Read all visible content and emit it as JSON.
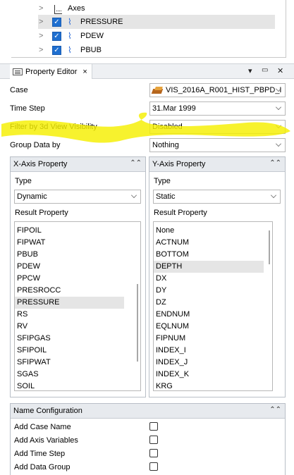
{
  "tree": {
    "items": [
      {
        "label": "Axes",
        "checked": false
      },
      {
        "label": "PRESSURE",
        "checked": true,
        "selected": true
      },
      {
        "label": "PDEW",
        "checked": true
      },
      {
        "label": "PBUB",
        "checked": true
      }
    ]
  },
  "property_editor": {
    "tab_title": "Property Editor",
    "tab_close": "×",
    "menu_glyph": "▾",
    "float_glyph": "🗗",
    "close_glyph": "✕"
  },
  "form": {
    "case_label": "Case",
    "case_value": "VIS_2016A_R001_HIST_PBPD_I",
    "time_step_label": "Time Step",
    "time_step_value": "31.Mar 1999",
    "filter_label": "Filter by 3d View Visibility",
    "filter_value": "Disabled",
    "group_label": "Group Data by",
    "group_value": "Nothing"
  },
  "x_axis": {
    "title": "X-Axis Property",
    "type_label": "Type",
    "type_value": "Dynamic",
    "result_label": "Result Property",
    "items": [
      "FIPOIL",
      "FIPWAT",
      "PBUB",
      "PDEW",
      "PPCW",
      "PRESROCC",
      "PRESSURE",
      "RS",
      "RV",
      "SFIPGAS",
      "SFIPOIL",
      "SFIPWAT",
      "SGAS",
      "SOIL"
    ],
    "selected": "PRESSURE"
  },
  "y_axis": {
    "title": "Y-Axis Property",
    "type_label": "Type",
    "type_value": "Static",
    "result_label": "Result Property",
    "items": [
      "None",
      "ACTNUM",
      "BOTTOM",
      "DEPTH",
      "DX",
      "DY",
      "DZ",
      "ENDNUM",
      "EQLNUM",
      "FIPNUM",
      "INDEX_I",
      "INDEX_J",
      "INDEX_K",
      "KRG"
    ],
    "selected": "DEPTH"
  },
  "name_config": {
    "title": "Name Configuration",
    "options": [
      {
        "label": "Add Case Name",
        "checked": false
      },
      {
        "label": "Add Axis Variables",
        "checked": false
      },
      {
        "label": "Add Time Step",
        "checked": false
      },
      {
        "label": "Add Data Group",
        "checked": false
      }
    ]
  },
  "colors": {
    "highlight": "#f5ef00",
    "checkbox_blue": "#1f6fd0",
    "selection": "#e5e5e5"
  }
}
